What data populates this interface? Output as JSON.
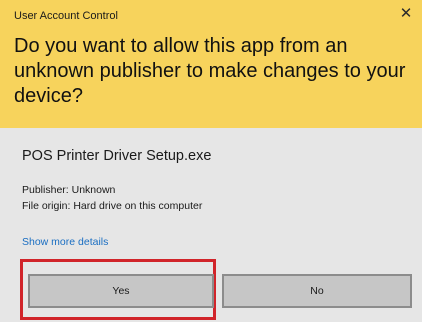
{
  "dialog": {
    "title": "User Account Control",
    "close_glyph": "✕",
    "question": "Do you want to allow this app from an unknown publisher to make changes to your device?",
    "app_name": "POS Printer Driver Setup.exe",
    "publisher": "Publisher: Unknown",
    "file_origin": "File origin: Hard drive on this computer",
    "more_details_link": "Show more details",
    "yes_label": "Yes",
    "no_label": "No"
  },
  "colors": {
    "header_bg": "#f7d35c",
    "body_bg": "#e6e6e6",
    "button_bg": "#c6c6c6",
    "link": "#1a6ec2",
    "highlight": "#d1242a"
  },
  "icons": {
    "close": "close-icon"
  }
}
